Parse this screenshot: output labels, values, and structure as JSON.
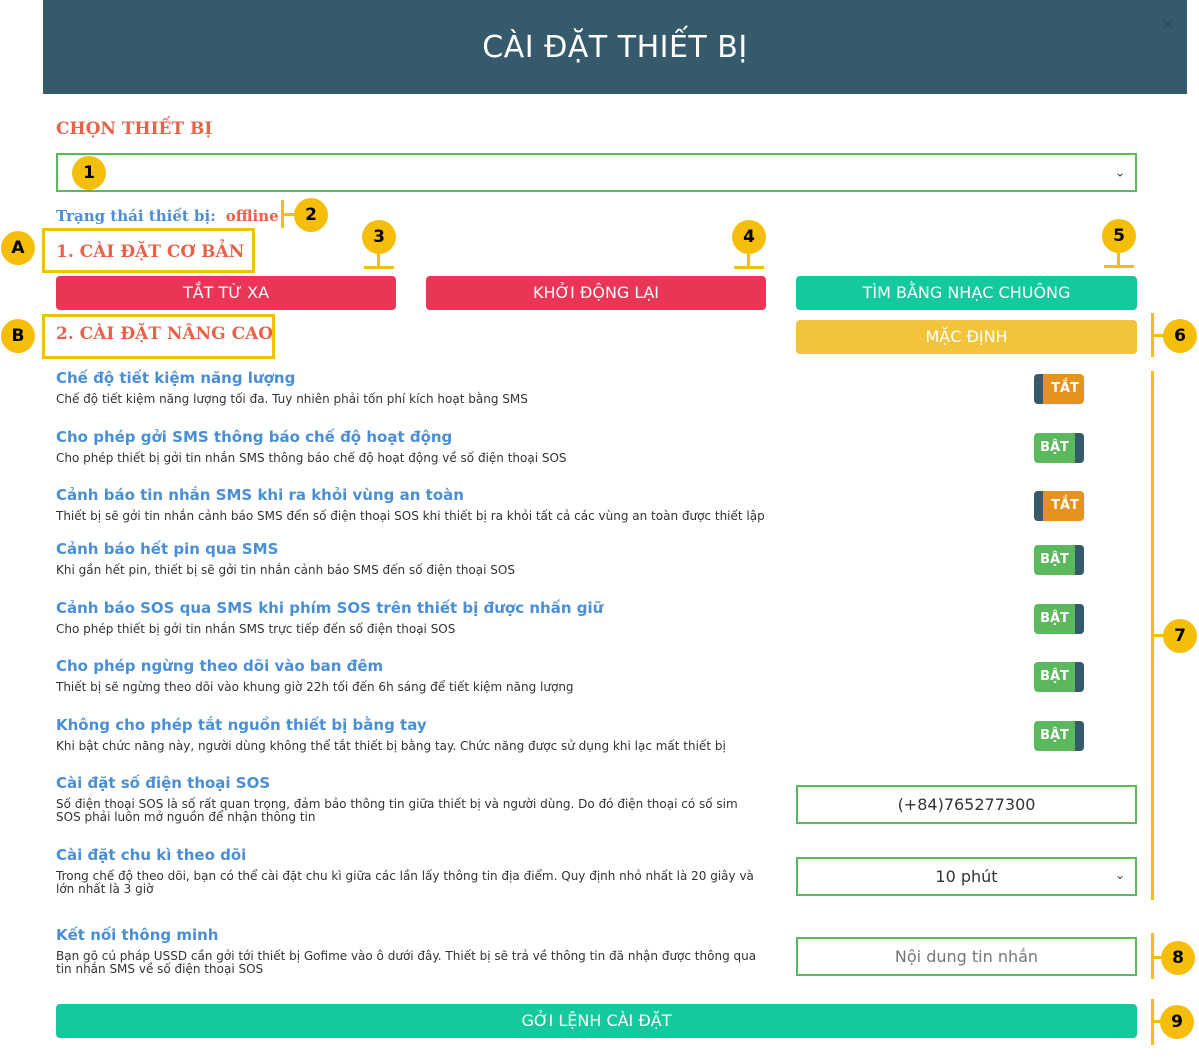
{
  "header": {
    "title": "CÀI ĐẶT THIẾT BỊ",
    "close_icon": "×"
  },
  "choose_device": {
    "label": "CHỌN THIẾT BỊ",
    "selected": "",
    "chevron": "⌄"
  },
  "status": {
    "label": "Trạng thái thiết bị:",
    "value": "offline"
  },
  "basic": {
    "title": "1. CÀI ĐẶT CƠ BẢN",
    "buttons": [
      "TẮT TỪ XA",
      "KHỞI ĐỘNG LẠI",
      "TÌM BẰNG NHẠC CHUÔNG"
    ]
  },
  "advanced": {
    "title": "2. CÀI ĐẶT NÂNG CAO",
    "default_button": "MẶC ĐỊNH",
    "settings": [
      {
        "title": "Chế độ tiết kiệm năng lượng",
        "desc": "Chế độ tiết kiệm năng lượng tối đa. Tuy nhiên phải tốn phí kích hoạt bằng SMS",
        "toggle": "TẮT"
      },
      {
        "title": "Cho phép gởi SMS thông báo chế độ hoạt động",
        "desc": "Cho phép thiết bị gởi tin nhắn SMS thông báo chế độ hoạt động về số điện thoại SOS",
        "toggle": "BẬT"
      },
      {
        "title": "Cảnh báo tin nhắn SMS khi ra khỏi vùng an toàn",
        "desc": "Thiết bị sẽ gởi tin nhắn cảnh báo SMS đến số điện thoại SOS khi thiết bị ra khỏi tất cả các vùng an toàn được thiết lập",
        "toggle": "TẮT"
      },
      {
        "title": "Cảnh báo hết pin qua SMS",
        "desc": "Khi gần hết pin, thiết bị sẽ gởi tin nhắn cảnh báo SMS đến số điện thoại SOS",
        "toggle": "BẬT"
      },
      {
        "title": "Cảnh báo SOS qua SMS khi phím SOS trên thiết bị được nhấn giữ",
        "desc": "Cho phép thiết bị gởi tin nhắn SMS trực tiếp đến số điện thoại SOS",
        "toggle": "BẬT"
      },
      {
        "title": "Cho phép ngừng theo dõi vào ban đêm",
        "desc": "Thiết bị sẽ ngừng theo dõi vào khung giờ 22h tối đến 6h sáng để tiết kiệm năng lượng",
        "toggle": "BẬT"
      },
      {
        "title": "Không cho phép tắt nguồn thiết bị bằng tay",
        "desc": "Khi bật chức năng này, người dùng không thể tắt thiết bị bằng tay. Chức năng được sử dụng khi lạc mất thiết bị",
        "toggle": "BẬT"
      }
    ],
    "sos": {
      "title": "Cài đặt số điện thoại SOS",
      "desc": "Số điện thoại SOS là số rất quan trọng, đảm bảo thông tin giữa thiết bị và người dùng. Do đó điện thoại có số sim SOS phải luôn mở nguồn để nhận thông tin",
      "value": "(+84)765277300"
    },
    "cycle": {
      "title": "Cài đặt chu kì theo dõi",
      "desc": "Trong chế độ theo dõi, bạn có thể cài đặt chu kì giữa các lần lấy thông tin địa điểm. Quy định nhỏ nhất là 20 giây và lớn nhất là 3 giờ",
      "value": "10 phút"
    },
    "smart": {
      "title": "Kết nối thông minh",
      "desc": "Bạn gõ cú pháp USSD cần gởi tới thiết bị Gofime vào ô dưới đây. Thiết bị sẽ trả về thông tin đã nhận được thông qua tin nhắn SMS về số điện thoại SOS",
      "placeholder": "Nội dung tin nhắn"
    }
  },
  "submit_button": "GỞI LỆNH CÀI ĐẶT",
  "annotations": {
    "letters": [
      "A",
      "B"
    ],
    "numbers": [
      "1",
      "2",
      "3",
      "4",
      "5",
      "6",
      "7",
      "8",
      "9"
    ]
  },
  "colors": {
    "header": "#355a6b",
    "accent_red": "#ea3556",
    "teal": "#14c99e",
    "yellow": "#f2c43b",
    "title_orange": "#e8624a",
    "label_blue": "#4a8fd6",
    "toggle_off": "#e8921e",
    "toggle_on": "#5cb85c",
    "annotation": "#f5be0b"
  }
}
